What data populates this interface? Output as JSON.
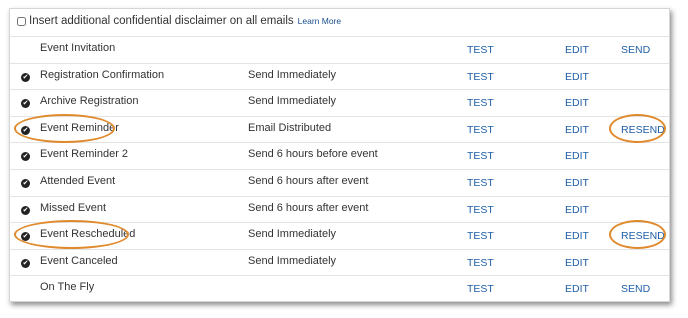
{
  "disclaimer": {
    "label": "Insert additional confidential disclaimer on all emails",
    "link": "Learn More",
    "checked": false
  },
  "actions": {
    "test": "TEST",
    "edit": "EDIT"
  },
  "rows": [
    {
      "name": "Event Invitation",
      "timing": "",
      "checked": false,
      "action": "SEND",
      "highlight": false
    },
    {
      "name": "Registration Confirmation",
      "timing": "Send Immediately",
      "checked": true,
      "action": "",
      "highlight": false
    },
    {
      "name": "Archive Registration",
      "timing": "Send Immediately",
      "checked": true,
      "action": "",
      "highlight": false
    },
    {
      "name": "Event Reminder",
      "timing": "Email Distributed",
      "checked": true,
      "action": "RESEND",
      "highlight": true
    },
    {
      "name": "Event Reminder 2",
      "timing": "Send 6 hours before event",
      "checked": true,
      "action": "",
      "highlight": false
    },
    {
      "name": "Attended Event",
      "timing": "Send 6 hours after event",
      "checked": true,
      "action": "",
      "highlight": false
    },
    {
      "name": "Missed Event",
      "timing": "Send 6 hours after event",
      "checked": true,
      "action": "",
      "highlight": false
    },
    {
      "name": "Event Rescheduled",
      "timing": "Send Immediately",
      "checked": true,
      "action": "RESEND",
      "highlight": true
    },
    {
      "name": "Event Canceled",
      "timing": "Send Immediately",
      "checked": true,
      "action": "",
      "highlight": false
    },
    {
      "name": "On The Fly",
      "timing": "",
      "checked": false,
      "action": "SEND",
      "highlight": false
    }
  ],
  "colors": {
    "link": "#1f5fa8",
    "highlight": "#e08a2e",
    "check": "#222222"
  },
  "icons": {
    "check": "check-circle-icon"
  }
}
